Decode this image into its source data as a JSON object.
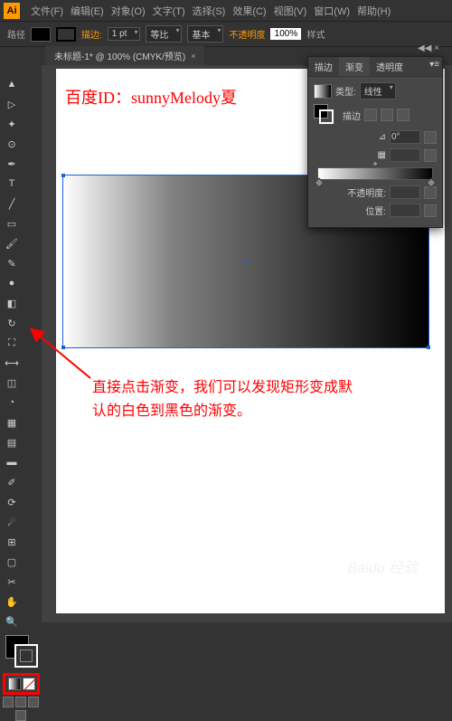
{
  "app": {
    "logo": "Ai"
  },
  "menu": [
    "文件(F)",
    "编辑(E)",
    "对象(O)",
    "文字(T)",
    "选择(S)",
    "效果(C)",
    "视图(V)",
    "窗口(W)",
    "帮助(H)"
  ],
  "option_bar": {
    "label": "路径",
    "fill_indicator_orange": "描边:",
    "stroke_width": "1 pt",
    "uniform": "等比",
    "basic": "基本",
    "opacity_label": "不透明度",
    "opacity_value": "100%",
    "style": "样式"
  },
  "doc_tab": {
    "name": "未标题-1* @ 100% (CMYK/预览)",
    "close": "×"
  },
  "watermark_id": "百度ID：sunnyMelody夏",
  "annotation_line1": "直接点击渐变，我们可以发现矩形变成默",
  "annotation_line2": "认的白色到黑色的渐变。",
  "gradient_panel": {
    "tabs": [
      "描边",
      "渐变",
      "透明度"
    ],
    "type_label": "类型:",
    "type_value": "线性",
    "stroke_label": "描边",
    "angle_label": "⊿",
    "angle_value": "0°",
    "aspect_label": "▦",
    "aspect_value": "",
    "opacity_label": "不透明度:",
    "opacity_value": "",
    "location_label": "位置:",
    "location_value": ""
  },
  "baidu_watermark": "Baidu 经验"
}
